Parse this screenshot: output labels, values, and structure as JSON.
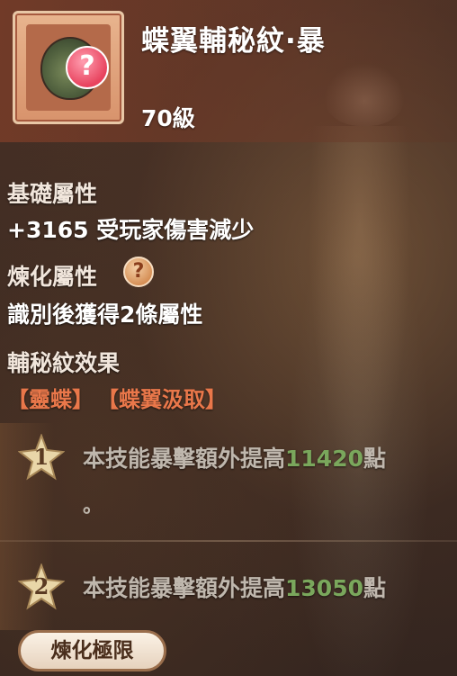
{
  "item": {
    "name": "蝶翼輔秘紋·暴",
    "level": "70級",
    "icon": "mystery-orb-icon"
  },
  "sections": {
    "base_label": "基礎屬性",
    "base_value": "+3165 受玩家傷害減少",
    "refine_label": "煉化屬性",
    "refine_value": "識別後獲得2條屬性",
    "effect_label": "輔秘紋效果",
    "tags": [
      "【靈蝶】",
      "【蝶翼汲取】"
    ]
  },
  "effects": [
    {
      "rank": "1",
      "text": "本技能暴擊額外提高",
      "value": "11420",
      "unit": "點",
      "tail": "。"
    },
    {
      "rank": "2",
      "text": "本技能暴擊額外提高",
      "value": "13050",
      "unit": "點"
    }
  ],
  "buttons": {
    "refine_limit": "煉化極限"
  },
  "colors": {
    "tag": "#e9774a",
    "highlight_number": "#7aa75c",
    "help_icon": "#d48c52"
  }
}
